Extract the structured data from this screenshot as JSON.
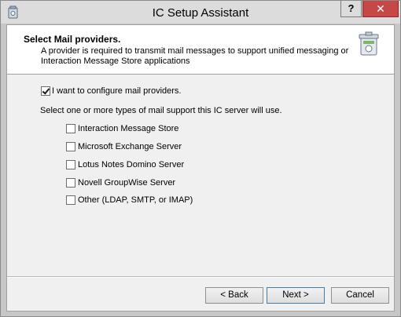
{
  "window": {
    "title": "IC Setup Assistant",
    "help_label": "?",
    "close_label": "✕"
  },
  "header": {
    "title": "Select Mail providers.",
    "description": "A provider is required to transmit mail messages to support unified messaging or Interaction Message Store applications",
    "icon": "wizard-bin-icon"
  },
  "main": {
    "configure_checkbox": {
      "label": "I want to configure mail providers.",
      "checked": true
    },
    "instruction": "Select one or more types of mail support this IC server will use.",
    "options": [
      {
        "label": "Interaction Message Store",
        "checked": false
      },
      {
        "label": "Microsoft Exchange Server",
        "checked": false
      },
      {
        "label": "Lotus Notes Domino Server",
        "checked": false
      },
      {
        "label": "Novell GroupWise Server",
        "checked": false
      },
      {
        "label": "Other (LDAP, SMTP, or IMAP)",
        "checked": false
      }
    ]
  },
  "footer": {
    "back_label": "< Back",
    "next_label": "Next >",
    "cancel_label": "Cancel"
  },
  "colors": {
    "close_button": "#c74646",
    "title_bar": "#dcdcdc",
    "client": "#f0f0f0"
  }
}
